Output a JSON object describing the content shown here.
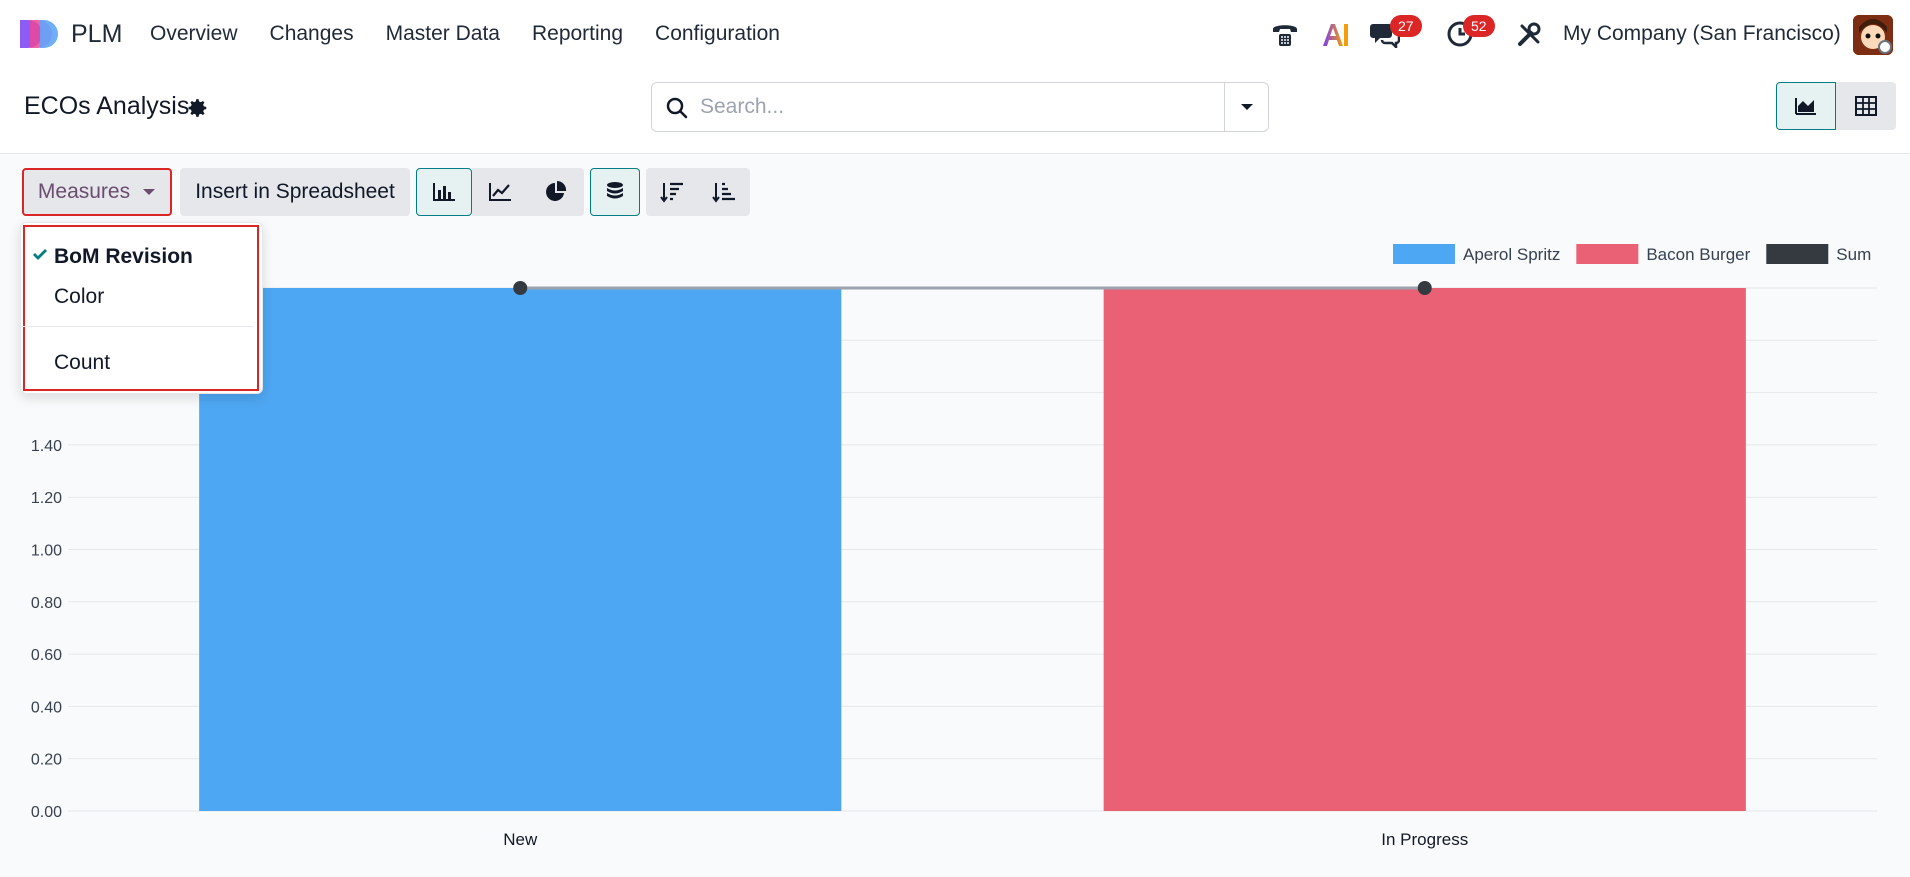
{
  "navbar": {
    "app_name": "PLM",
    "menu": [
      "Overview",
      "Changes",
      "Master Data",
      "Reporting",
      "Configuration"
    ],
    "messages_badge": "27",
    "activities_badge": "52",
    "company": "My Company (San Francisco)",
    "ai_label": "AI"
  },
  "control": {
    "title": "ECOs Analysis",
    "search_placeholder": "Search..."
  },
  "toolbar": {
    "measures_label": "Measures",
    "insert_label": "Insert in Spreadsheet"
  },
  "measures_dropdown": {
    "items": [
      {
        "label": "BoM Revision",
        "selected": true
      },
      {
        "label": "Color",
        "selected": false
      },
      {
        "label": "Count",
        "selected": false
      }
    ]
  },
  "chart_data": {
    "type": "bar",
    "categories": [
      "New",
      "In Progress"
    ],
    "series": [
      {
        "name": "Aperol Spritz",
        "color": "#4ea7f2",
        "values": [
          2.0,
          null
        ]
      },
      {
        "name": "Bacon Burger",
        "color": "#ea6175",
        "values": [
          null,
          2.0
        ]
      },
      {
        "name": "Sum",
        "color": "#343a40",
        "type": "line",
        "values": [
          2.0,
          2.0
        ]
      }
    ],
    "y_ticks": [
      "0.00",
      "0.20",
      "0.40",
      "0.60",
      "0.80",
      "1.00",
      "1.20",
      "1.40"
    ],
    "ylim": [
      0,
      2.0
    ],
    "grid": true,
    "legend_position": "top-right"
  }
}
